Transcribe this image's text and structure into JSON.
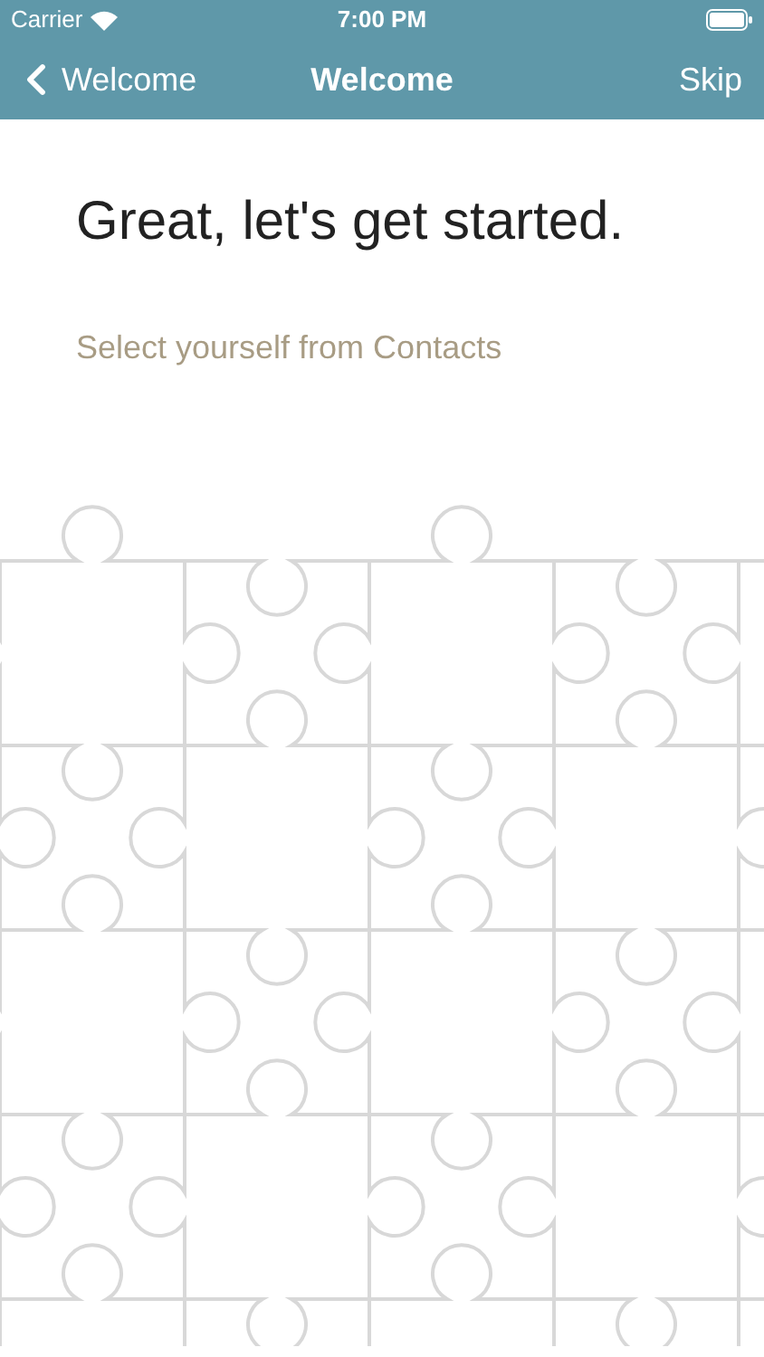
{
  "status_bar": {
    "carrier": "Carrier",
    "time": "7:00 PM"
  },
  "nav_bar": {
    "back_label": "Welcome",
    "title": "Welcome",
    "action": "Skip"
  },
  "heading": "Great, let's get started.",
  "prompt": "Select yourself from Contacts"
}
